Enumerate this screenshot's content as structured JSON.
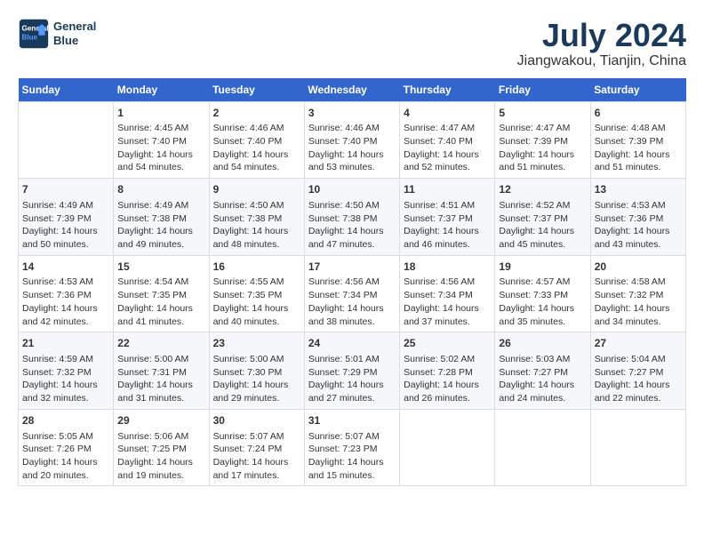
{
  "logo": {
    "line1": "General",
    "line2": "Blue"
  },
  "title": "July 2024",
  "subtitle": "Jiangwakou, Tianjin, China",
  "headers": [
    "Sunday",
    "Monday",
    "Tuesday",
    "Wednesday",
    "Thursday",
    "Friday",
    "Saturday"
  ],
  "weeks": [
    [
      {
        "day": "",
        "info": ""
      },
      {
        "day": "1",
        "info": "Sunrise: 4:45 AM\nSunset: 7:40 PM\nDaylight: 14 hours\nand 54 minutes."
      },
      {
        "day": "2",
        "info": "Sunrise: 4:46 AM\nSunset: 7:40 PM\nDaylight: 14 hours\nand 54 minutes."
      },
      {
        "day": "3",
        "info": "Sunrise: 4:46 AM\nSunset: 7:40 PM\nDaylight: 14 hours\nand 53 minutes."
      },
      {
        "day": "4",
        "info": "Sunrise: 4:47 AM\nSunset: 7:40 PM\nDaylight: 14 hours\nand 52 minutes."
      },
      {
        "day": "5",
        "info": "Sunrise: 4:47 AM\nSunset: 7:39 PM\nDaylight: 14 hours\nand 51 minutes."
      },
      {
        "day": "6",
        "info": "Sunrise: 4:48 AM\nSunset: 7:39 PM\nDaylight: 14 hours\nand 51 minutes."
      }
    ],
    [
      {
        "day": "7",
        "info": "Sunrise: 4:49 AM\nSunset: 7:39 PM\nDaylight: 14 hours\nand 50 minutes."
      },
      {
        "day": "8",
        "info": "Sunrise: 4:49 AM\nSunset: 7:38 PM\nDaylight: 14 hours\nand 49 minutes."
      },
      {
        "day": "9",
        "info": "Sunrise: 4:50 AM\nSunset: 7:38 PM\nDaylight: 14 hours\nand 48 minutes."
      },
      {
        "day": "10",
        "info": "Sunrise: 4:50 AM\nSunset: 7:38 PM\nDaylight: 14 hours\nand 47 minutes."
      },
      {
        "day": "11",
        "info": "Sunrise: 4:51 AM\nSunset: 7:37 PM\nDaylight: 14 hours\nand 46 minutes."
      },
      {
        "day": "12",
        "info": "Sunrise: 4:52 AM\nSunset: 7:37 PM\nDaylight: 14 hours\nand 45 minutes."
      },
      {
        "day": "13",
        "info": "Sunrise: 4:53 AM\nSunset: 7:36 PM\nDaylight: 14 hours\nand 43 minutes."
      }
    ],
    [
      {
        "day": "14",
        "info": "Sunrise: 4:53 AM\nSunset: 7:36 PM\nDaylight: 14 hours\nand 42 minutes."
      },
      {
        "day": "15",
        "info": "Sunrise: 4:54 AM\nSunset: 7:35 PM\nDaylight: 14 hours\nand 41 minutes."
      },
      {
        "day": "16",
        "info": "Sunrise: 4:55 AM\nSunset: 7:35 PM\nDaylight: 14 hours\nand 40 minutes."
      },
      {
        "day": "17",
        "info": "Sunrise: 4:56 AM\nSunset: 7:34 PM\nDaylight: 14 hours\nand 38 minutes."
      },
      {
        "day": "18",
        "info": "Sunrise: 4:56 AM\nSunset: 7:34 PM\nDaylight: 14 hours\nand 37 minutes."
      },
      {
        "day": "19",
        "info": "Sunrise: 4:57 AM\nSunset: 7:33 PM\nDaylight: 14 hours\nand 35 minutes."
      },
      {
        "day": "20",
        "info": "Sunrise: 4:58 AM\nSunset: 7:32 PM\nDaylight: 14 hours\nand 34 minutes."
      }
    ],
    [
      {
        "day": "21",
        "info": "Sunrise: 4:59 AM\nSunset: 7:32 PM\nDaylight: 14 hours\nand 32 minutes."
      },
      {
        "day": "22",
        "info": "Sunrise: 5:00 AM\nSunset: 7:31 PM\nDaylight: 14 hours\nand 31 minutes."
      },
      {
        "day": "23",
        "info": "Sunrise: 5:00 AM\nSunset: 7:30 PM\nDaylight: 14 hours\nand 29 minutes."
      },
      {
        "day": "24",
        "info": "Sunrise: 5:01 AM\nSunset: 7:29 PM\nDaylight: 14 hours\nand 27 minutes."
      },
      {
        "day": "25",
        "info": "Sunrise: 5:02 AM\nSunset: 7:28 PM\nDaylight: 14 hours\nand 26 minutes."
      },
      {
        "day": "26",
        "info": "Sunrise: 5:03 AM\nSunset: 7:27 PM\nDaylight: 14 hours\nand 24 minutes."
      },
      {
        "day": "27",
        "info": "Sunrise: 5:04 AM\nSunset: 7:27 PM\nDaylight: 14 hours\nand 22 minutes."
      }
    ],
    [
      {
        "day": "28",
        "info": "Sunrise: 5:05 AM\nSunset: 7:26 PM\nDaylight: 14 hours\nand 20 minutes."
      },
      {
        "day": "29",
        "info": "Sunrise: 5:06 AM\nSunset: 7:25 PM\nDaylight: 14 hours\nand 19 minutes."
      },
      {
        "day": "30",
        "info": "Sunrise: 5:07 AM\nSunset: 7:24 PM\nDaylight: 14 hours\nand 17 minutes."
      },
      {
        "day": "31",
        "info": "Sunrise: 5:07 AM\nSunset: 7:23 PM\nDaylight: 14 hours\nand 15 minutes."
      },
      {
        "day": "",
        "info": ""
      },
      {
        "day": "",
        "info": ""
      },
      {
        "day": "",
        "info": ""
      }
    ]
  ]
}
